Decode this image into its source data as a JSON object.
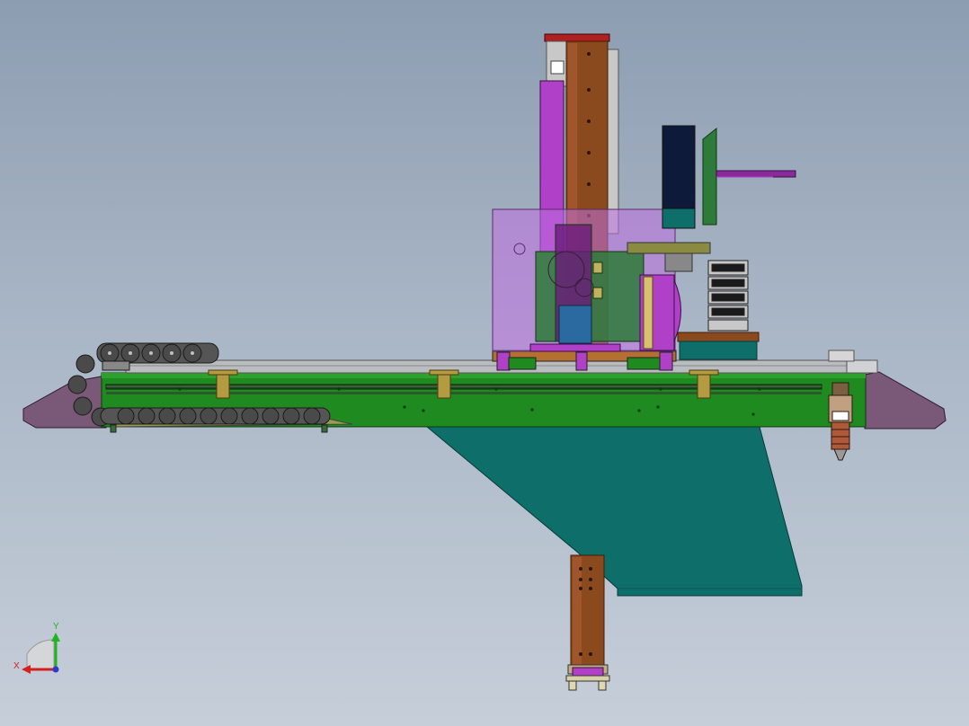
{
  "viewport": {
    "background_top": "#8d9db1",
    "background_bottom": "#c6ced9"
  },
  "triad": {
    "x_label": "X",
    "y_label": "Y",
    "x_color": "#d62020",
    "y_color": "#1fb51f",
    "z_color": "#2a3ccf"
  },
  "colors": {
    "rail_green": "#1f8a1f",
    "teal": "#0e6e6a",
    "purple_end": "#7a5878",
    "magenta": "#b040c8",
    "transparent_magenta": "#c070e0",
    "brown": "#8a4a1e",
    "rail_grey": "#b9bcc0",
    "chain_dark": "#4a4a4a",
    "yellow_bracket": "#b49a40"
  }
}
